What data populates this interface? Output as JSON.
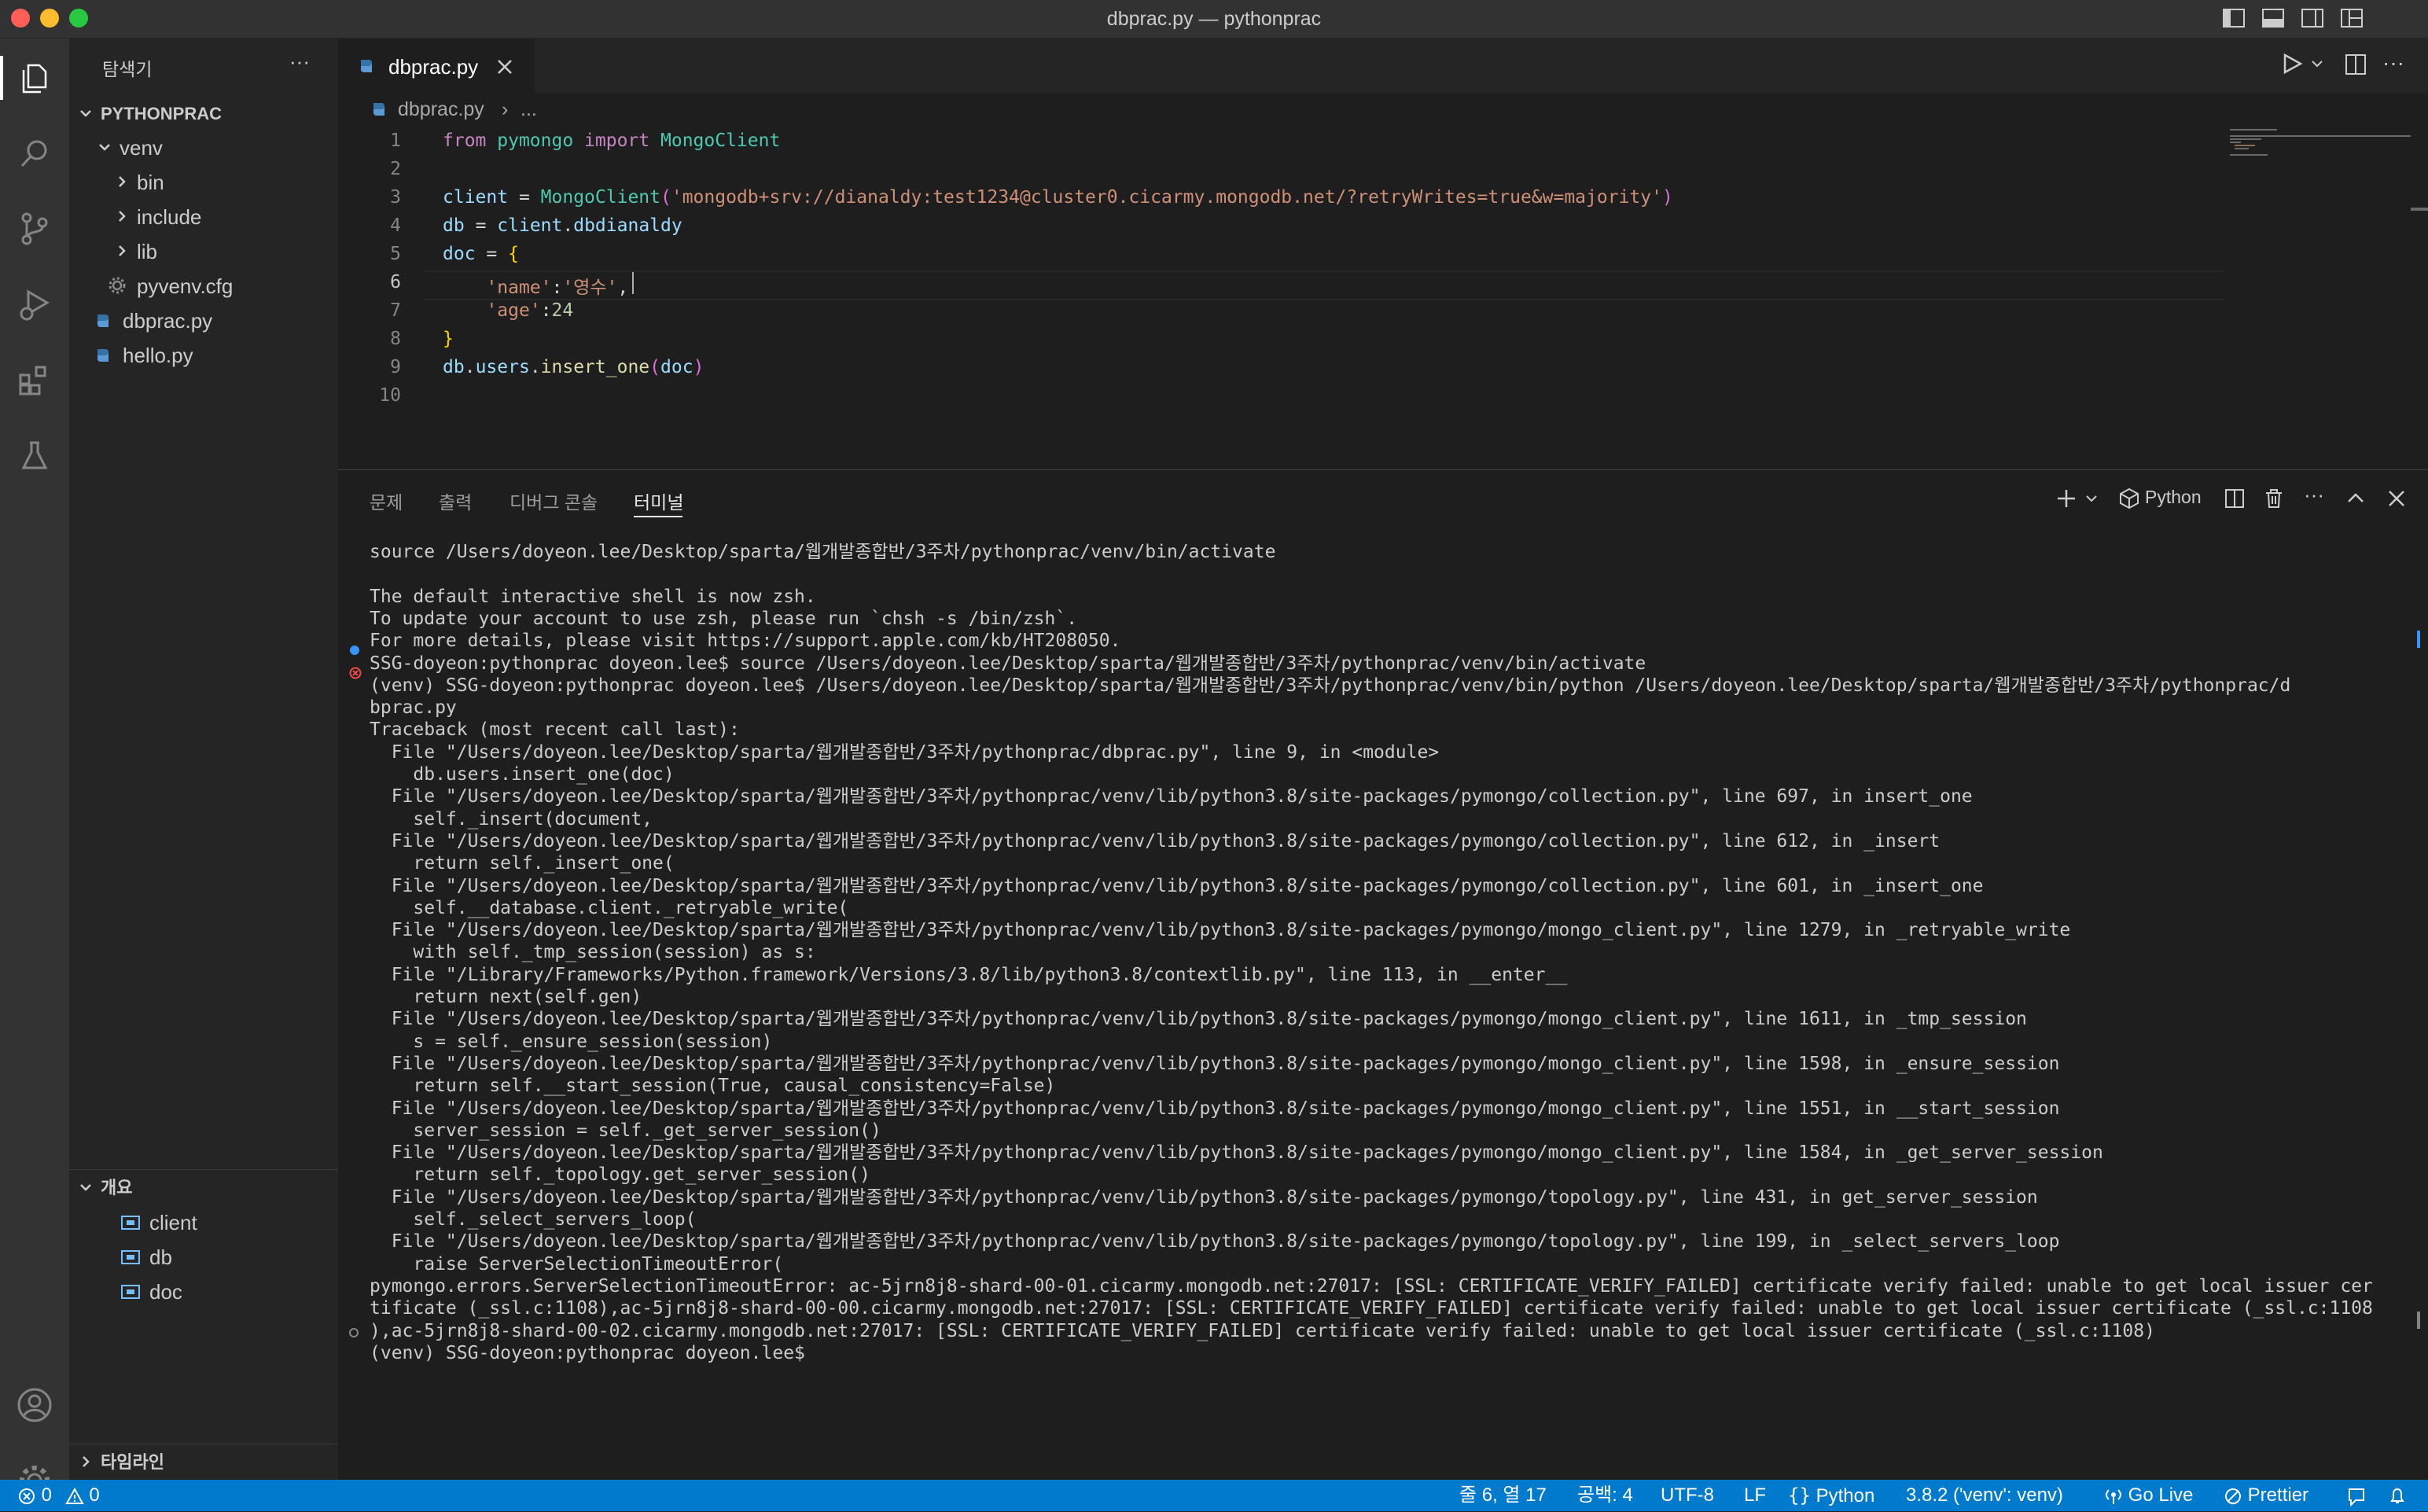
{
  "window": {
    "title": "dbprac.py — pythonprac"
  },
  "sidebar": {
    "explorer_title": "탐색기",
    "more_label": "···",
    "root": "PYTHONPRAC",
    "tree": [
      {
        "label": "venv",
        "icon": "chevron-down-icon",
        "depth": 1
      },
      {
        "label": "bin",
        "icon": "chevron-right-icon",
        "depth": 2
      },
      {
        "label": "include",
        "icon": "chevron-right-icon",
        "depth": 2
      },
      {
        "label": "lib",
        "icon": "chevron-right-icon",
        "depth": 2
      },
      {
        "label": "pyvenv.cfg",
        "icon": "gear-icon",
        "depth": 2
      },
      {
        "label": "dbprac.py",
        "icon": "python-file-icon",
        "depth": 1
      },
      {
        "label": "hello.py",
        "icon": "python-file-icon",
        "depth": 1
      }
    ],
    "outline_title": "개요",
    "outline": [
      "client",
      "db",
      "doc"
    ],
    "timeline_title": "타임라인"
  },
  "editor": {
    "tab_label": "dbprac.py",
    "breadcrumb_file": "dbprac.py",
    "breadcrumb_rest": "...",
    "lines": [
      {
        "n": "1",
        "text": "from pymongo import MongoClient"
      },
      {
        "n": "2",
        "text": ""
      },
      {
        "n": "3",
        "text": "client = MongoClient('mongodb+srv://dianaldy:test1234@cluster0.cicarmy.mongodb.net/?retryWrites=true&w=majority')"
      },
      {
        "n": "4",
        "text": "db = client.dbdianaldy"
      },
      {
        "n": "5",
        "text": "doc = {"
      },
      {
        "n": "6",
        "text": "    'name':'영수',"
      },
      {
        "n": "7",
        "text": "    'age':24"
      },
      {
        "n": "8",
        "text": "}"
      },
      {
        "n": "9",
        "text": "db.users.insert_one(doc)"
      },
      {
        "n": "10",
        "text": ""
      }
    ]
  },
  "panel": {
    "tabs": [
      "문제",
      "출력",
      "디버그 콘솔",
      "터미널"
    ],
    "active_tab": "터미널",
    "shell_label": "Python",
    "terminal": [
      "source /Users/doyeon.lee/Desktop/sparta/웹개발종합반/3주차/pythonprac/venv/bin/activate",
      "",
      "The default interactive shell is now zsh.",
      "To update your account to use zsh, please run `chsh -s /bin/zsh`.",
      "For more details, please visit https://support.apple.com/kb/HT208050.",
      "SSG-doyeon:pythonprac doyeon.lee$ source /Users/doyeon.lee/Desktop/sparta/웹개발종합반/3주차/pythonprac/venv/bin/activate",
      "(venv) SSG-doyeon:pythonprac doyeon.lee$ /Users/doyeon.lee/Desktop/sparta/웹개발종합반/3주차/pythonprac/venv/bin/python /Users/doyeon.lee/Desktop/sparta/웹개발종합반/3주차/pythonprac/d",
      "bprac.py",
      "Traceback (most recent call last):",
      "  File \"/Users/doyeon.lee/Desktop/sparta/웹개발종합반/3주차/pythonprac/dbprac.py\", line 9, in <module>",
      "    db.users.insert_one(doc)",
      "  File \"/Users/doyeon.lee/Desktop/sparta/웹개발종합반/3주차/pythonprac/venv/lib/python3.8/site-packages/pymongo/collection.py\", line 697, in insert_one",
      "    self._insert(document,",
      "  File \"/Users/doyeon.lee/Desktop/sparta/웹개발종합반/3주차/pythonprac/venv/lib/python3.8/site-packages/pymongo/collection.py\", line 612, in _insert",
      "    return self._insert_one(",
      "  File \"/Users/doyeon.lee/Desktop/sparta/웹개발종합반/3주차/pythonprac/venv/lib/python3.8/site-packages/pymongo/collection.py\", line 601, in _insert_one",
      "    self.__database.client._retryable_write(",
      "  File \"/Users/doyeon.lee/Desktop/sparta/웹개발종합반/3주차/pythonprac/venv/lib/python3.8/site-packages/pymongo/mongo_client.py\", line 1279, in _retryable_write",
      "    with self._tmp_session(session) as s:",
      "  File \"/Library/Frameworks/Python.framework/Versions/3.8/lib/python3.8/contextlib.py\", line 113, in __enter__",
      "    return next(self.gen)",
      "  File \"/Users/doyeon.lee/Desktop/sparta/웹개발종합반/3주차/pythonprac/venv/lib/python3.8/site-packages/pymongo/mongo_client.py\", line 1611, in _tmp_session",
      "    s = self._ensure_session(session)",
      "  File \"/Users/doyeon.lee/Desktop/sparta/웹개발종합반/3주차/pythonprac/venv/lib/python3.8/site-packages/pymongo/mongo_client.py\", line 1598, in _ensure_session",
      "    return self.__start_session(True, causal_consistency=False)",
      "  File \"/Users/doyeon.lee/Desktop/sparta/웹개발종합반/3주차/pythonprac/venv/lib/python3.8/site-packages/pymongo/mongo_client.py\", line 1551, in __start_session",
      "    server_session = self._get_server_session()",
      "  File \"/Users/doyeon.lee/Desktop/sparta/웹개발종합반/3주차/pythonprac/venv/lib/python3.8/site-packages/pymongo/mongo_client.py\", line 1584, in _get_server_session",
      "    return self._topology.get_server_session()",
      "  File \"/Users/doyeon.lee/Desktop/sparta/웹개발종합반/3주차/pythonprac/venv/lib/python3.8/site-packages/pymongo/topology.py\", line 431, in get_server_session",
      "    self._select_servers_loop(",
      "  File \"/Users/doyeon.lee/Desktop/sparta/웹개발종합반/3주차/pythonprac/venv/lib/python3.8/site-packages/pymongo/topology.py\", line 199, in _select_servers_loop",
      "    raise ServerSelectionTimeoutError(",
      "pymongo.errors.ServerSelectionTimeoutError: ac-5jrn8j8-shard-00-01.cicarmy.mongodb.net:27017: [SSL: CERTIFICATE_VERIFY_FAILED] certificate verify failed: unable to get local issuer cer",
      "tificate (_ssl.c:1108),ac-5jrn8j8-shard-00-00.cicarmy.mongodb.net:27017: [SSL: CERTIFICATE_VERIFY_FAILED] certificate verify failed: unable to get local issuer certificate (_ssl.c:1108",
      "),ac-5jrn8j8-shard-00-02.cicarmy.mongodb.net:27017: [SSL: CERTIFICATE_VERIFY_FAILED] certificate verify failed: unable to get local issuer certificate (_ssl.c:1108)",
      "(venv) SSG-doyeon:pythonprac doyeon.lee$"
    ]
  },
  "statusbar": {
    "errors": "0",
    "warnings": "0",
    "position": "줄 6, 열 17",
    "spaces": "공백: 4",
    "encoding": "UTF-8",
    "eol": "LF",
    "language": "Python",
    "interpreter": "3.8.2 ('venv': venv)",
    "golive": "Go Live",
    "prettier": "Prettier"
  },
  "colors": {
    "accent": "#007acc",
    "error": "#f14c4c",
    "info": "#3794ff"
  }
}
